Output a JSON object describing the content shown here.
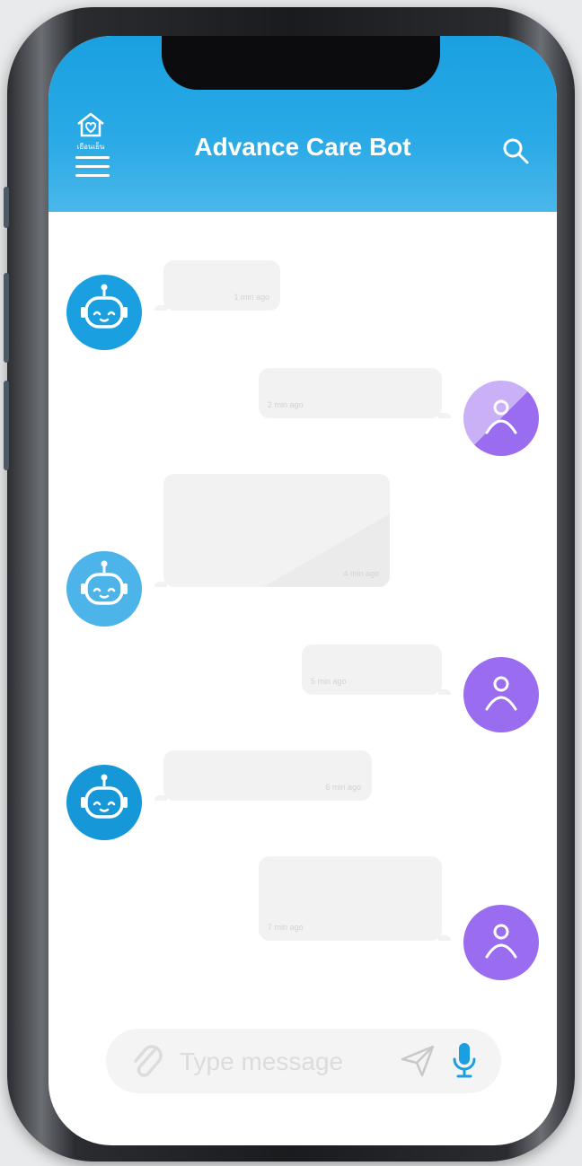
{
  "app": {
    "title": "Advance Care Bot",
    "logo_caption": "เยือนเย็น"
  },
  "colors": {
    "header": "#1aa0e0",
    "bot_avatar": "#1aa0e0",
    "user_avatar": "#9a6cf0",
    "bubble": "#f2f2f3"
  },
  "messages": [
    {
      "sender": "bot",
      "time": "1 min ago"
    },
    {
      "sender": "user",
      "time": "2 min ago"
    },
    {
      "sender": "bot",
      "time": "4 min ago"
    },
    {
      "sender": "user",
      "time": "5 min ago"
    },
    {
      "sender": "bot",
      "time": "6 min ago"
    },
    {
      "sender": "user",
      "time": "7 min ago"
    }
  ],
  "composer": {
    "placeholder": "Type message"
  },
  "icons": {
    "menu": "hamburger-icon",
    "search": "search-icon",
    "attach": "paperclip-icon",
    "send": "send-icon",
    "mic": "microphone-icon",
    "bot": "robot-icon",
    "user": "user-icon"
  }
}
